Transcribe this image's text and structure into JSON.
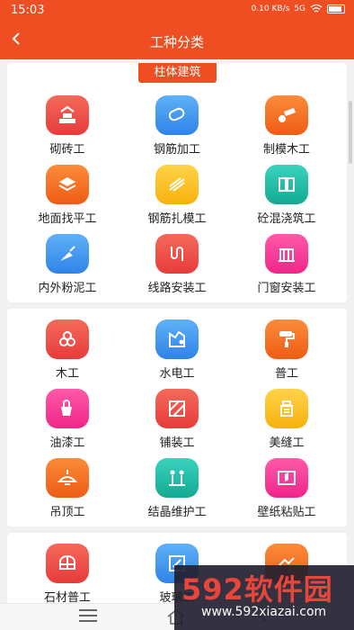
{
  "status_bar": {
    "time": "15:03",
    "net": "0.10 KB/s",
    "signal": "5G",
    "battery": ""
  },
  "header": {
    "back": "<",
    "title": "工种分类"
  },
  "sections": [
    {
      "tag": "柱体建筑",
      "items": [
        {
          "label": "砌砖工",
          "icon": "brick-wall-icon",
          "color": "red"
        },
        {
          "label": "钢筋加工",
          "icon": "rebar-icon",
          "color": "blue"
        },
        {
          "label": "制模木工",
          "icon": "wood-logs-icon",
          "color": "orange"
        },
        {
          "label": "地面找平工",
          "icon": "layers-icon",
          "color": "orange"
        },
        {
          "label": "钢筋扎模工",
          "icon": "bundle-icon",
          "color": "yellow"
        },
        {
          "label": "砼混浇筑工",
          "icon": "concrete-icon",
          "color": "teal"
        },
        {
          "label": "内外粉泥工",
          "icon": "trowel-icon",
          "color": "blue"
        },
        {
          "label": "线路安装工",
          "icon": "wiring-icon",
          "color": "red"
        },
        {
          "label": "门窗安装工",
          "icon": "door-window-icon",
          "color": "pink"
        }
      ]
    },
    {
      "tag": "",
      "items": [
        {
          "label": "木工",
          "icon": "logs-icon",
          "color": "red"
        },
        {
          "label": "水电工",
          "icon": "plumbing-icon",
          "color": "blue"
        },
        {
          "label": "普工",
          "icon": "paint-roller-icon",
          "color": "orange"
        },
        {
          "label": "油漆工",
          "icon": "paint-bucket-icon",
          "color": "pink"
        },
        {
          "label": "铺装工",
          "icon": "tile-icon",
          "color": "red"
        },
        {
          "label": "美缝工",
          "icon": "sealant-icon",
          "color": "yellow"
        },
        {
          "label": "吊顶工",
          "icon": "ceiling-lamp-icon",
          "color": "orange"
        },
        {
          "label": "结晶维护工",
          "icon": "maintenance-icon",
          "color": "teal"
        },
        {
          "label": "壁纸粘贴工",
          "icon": "wallpaper-icon",
          "color": "pink"
        }
      ]
    },
    {
      "tag": "",
      "items": [
        {
          "label": "石材普工",
          "icon": "stone-icon",
          "color": "red"
        },
        {
          "label": "玻璃工",
          "icon": "glass-icon",
          "color": "blue"
        },
        {
          "label": "",
          "icon": "tool-icon",
          "color": "orange"
        }
      ]
    }
  ],
  "watermark": {
    "text": "592软件园",
    "url": "www.592xiazai.com"
  }
}
